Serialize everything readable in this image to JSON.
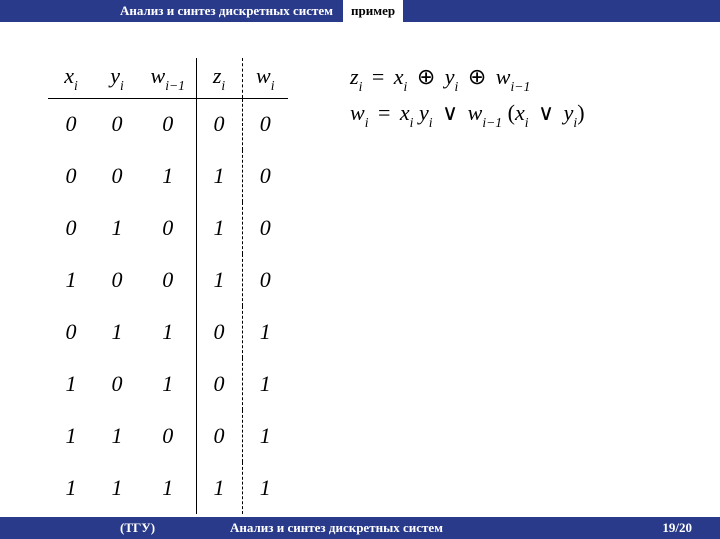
{
  "header": {
    "title": "Анализ и синтез дискретных систем",
    "subtitle": "пример"
  },
  "table": {
    "cols": {
      "c1": {
        "var": "x",
        "sub": "i"
      },
      "c2": {
        "var": "y",
        "sub": "i"
      },
      "c3": {
        "var": "w",
        "sub": "i−1"
      },
      "c4": {
        "var": "z",
        "sub": "i"
      },
      "c5": {
        "var": "w",
        "sub": "i"
      }
    },
    "rows": [
      [
        "0",
        "0",
        "0",
        "0",
        "0"
      ],
      [
        "0",
        "0",
        "1",
        "1",
        "0"
      ],
      [
        "0",
        "1",
        "0",
        "1",
        "0"
      ],
      [
        "1",
        "0",
        "0",
        "1",
        "0"
      ],
      [
        "0",
        "1",
        "1",
        "0",
        "1"
      ],
      [
        "1",
        "0",
        "1",
        "0",
        "1"
      ],
      [
        "1",
        "1",
        "0",
        "0",
        "1"
      ],
      [
        "1",
        "1",
        "1",
        "1",
        "1"
      ]
    ]
  },
  "formulas": {
    "f1": {
      "lhs_var": "z",
      "lhs_sub": "i",
      "eq": "=",
      "t1_var": "x",
      "t1_sub": "i",
      "op1": "⊕",
      "t2_var": "y",
      "t2_sub": "i",
      "op2": "⊕",
      "t3_var": "w",
      "t3_sub": "i−1"
    },
    "f2": {
      "lhs_var": "w",
      "lhs_sub": "i",
      "eq": "=",
      "t1_var": "x",
      "t1_sub": "i",
      "t2_var": "y",
      "t2_sub": "i",
      "op1": "∨",
      "t3_var": "w",
      "t3_sub": "i−1",
      "lp": "(",
      "t4_var": "x",
      "t4_sub": "i",
      "op2": "∨",
      "t5_var": "y",
      "t5_sub": "i",
      "rp": ")"
    }
  },
  "footer": {
    "left": "(ТГУ)",
    "center": "Анализ и синтез дискретных систем",
    "right": "19/20"
  }
}
